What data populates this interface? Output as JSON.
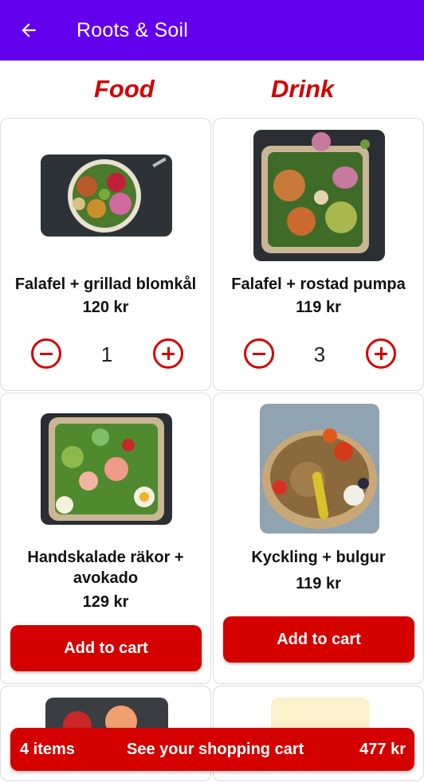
{
  "appbar": {
    "title": "Roots & Soil",
    "back_icon": "arrow-back-icon"
  },
  "tabs": [
    {
      "label": "Food",
      "active": true
    },
    {
      "label": "Drink",
      "active": false
    }
  ],
  "products": [
    {
      "name": "Falafel + grillad blomkål",
      "price": "120 kr",
      "quantity": "1",
      "image": "falafel-cauliflower-bowl"
    },
    {
      "name": "Falafel + rostad pumpa",
      "price": "119 kr",
      "quantity": "3",
      "image": "falafel-pumpkin-bowl"
    },
    {
      "name": "Handskalade räkor + avokado",
      "price": "129 kr",
      "button": "Add to cart",
      "image": "shrimp-avocado-bowl"
    },
    {
      "name": "Kyckling + bulgur",
      "price": "119 kr",
      "button": "Add to cart",
      "image": "chicken-bulgur-bowl"
    }
  ],
  "cart": {
    "items": "4 items",
    "label": "See your shopping cart",
    "total": "477 kr"
  },
  "colors": {
    "appbar": "#6200ee",
    "accent": "#d40000"
  }
}
